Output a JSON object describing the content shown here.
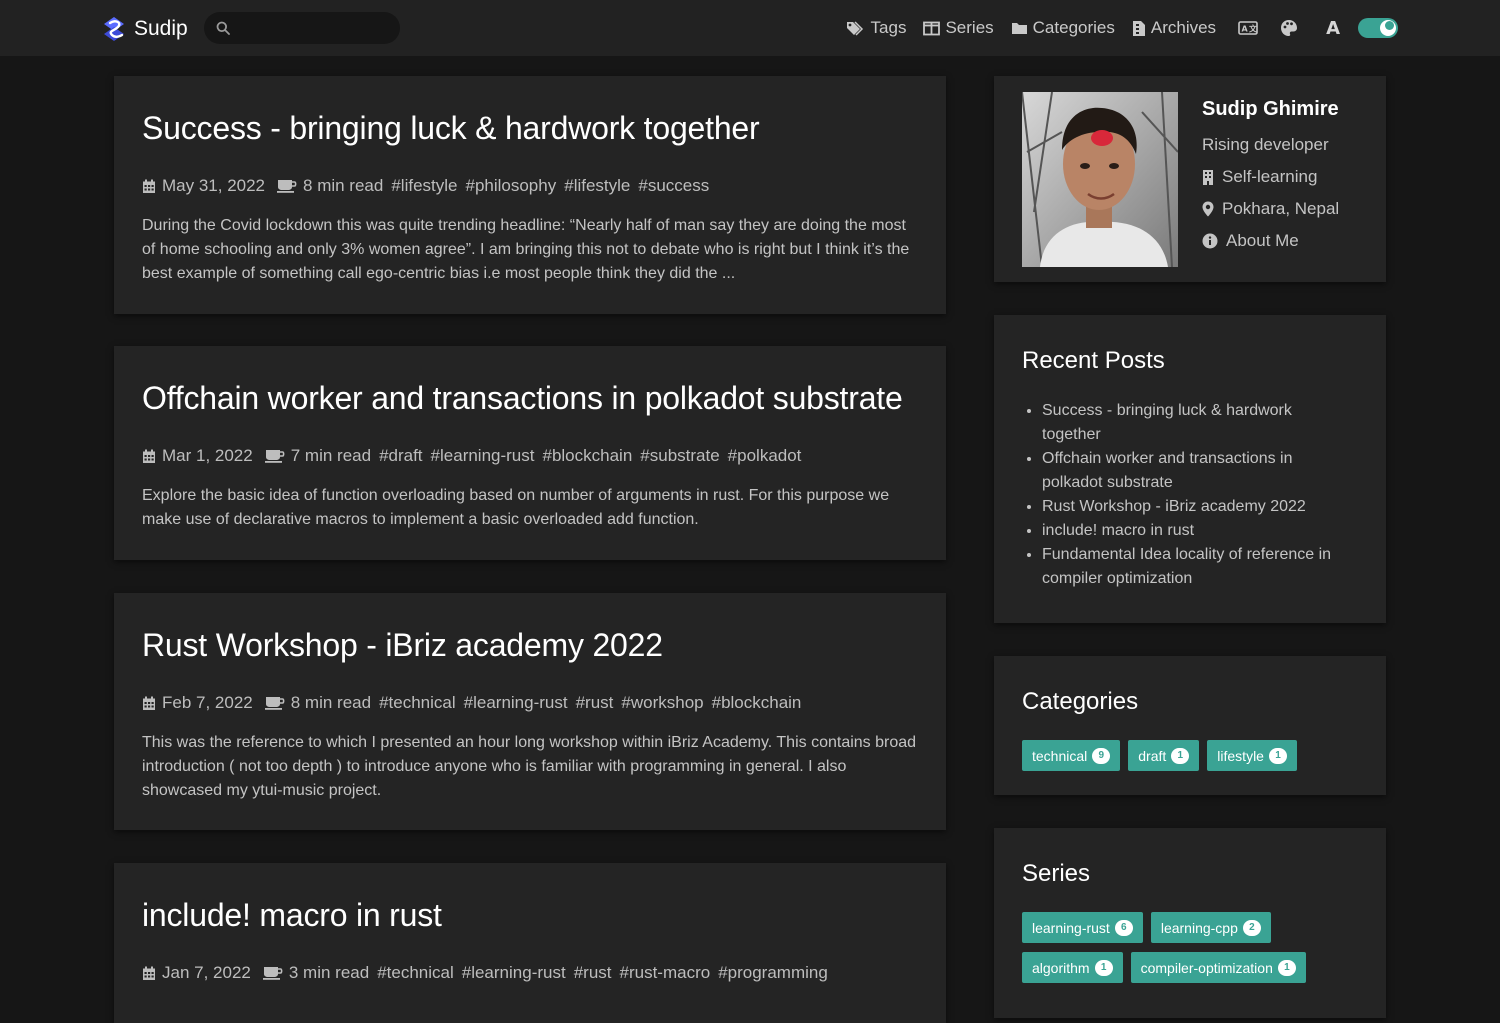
{
  "nav": {
    "brand": "Sudip",
    "search_placeholder": "",
    "links": [
      {
        "label": "Tags",
        "icon": "tags-icon"
      },
      {
        "label": "Series",
        "icon": "series-icon"
      },
      {
        "label": "Categories",
        "icon": "folder-icon"
      },
      {
        "label": "Archives",
        "icon": "archive-icon"
      }
    ],
    "language_icon": "translate-icon",
    "theme_icon": "palette-icon",
    "font_icon": "font-icon",
    "font_glyph": "A",
    "dark_mode": "on"
  },
  "posts": [
    {
      "title": "Success - bringing luck & hardwork together",
      "date": "May 31, 2022",
      "read": "8 min read",
      "tags": [
        "#lifestyle",
        "#philosophy",
        "#lifestyle",
        "#success"
      ],
      "summary": "During the Covid lockdown this was quite trending headline: “Nearly half of man say they are doing the most of home schooling and only 3% women agree”. I am bringing this not to debate who is right but I think it’s the best example of something call ego-centric bias i.e most people think they did the ..."
    },
    {
      "title": "Offchain worker and transactions in polkadot substrate",
      "date": "Mar 1, 2022",
      "read": "7 min read",
      "tags": [
        "#draft",
        "#learning-rust",
        "#blockchain",
        "#substrate",
        "#polkadot"
      ],
      "summary": "Explore the basic idea of function overloading based on number of arguments in rust. For this purpose we make use of declarative macros to implement a basic overloaded add function."
    },
    {
      "title": "Rust Workshop - iBriz academy 2022",
      "date": "Feb 7, 2022",
      "read": "8 min read",
      "tags": [
        "#technical",
        "#learning-rust",
        "#rust",
        "#workshop",
        "#blockchain"
      ],
      "summary": "This was the reference to which I presented an hour long workshop within iBriz Academy. This contains broad introduction ( not too depth ) to introduce anyone who is familiar with programming in general. I also showcased my ytui-music project."
    },
    {
      "title": "include! macro in rust",
      "date": "Jan 7, 2022",
      "read": "3 min read",
      "tags": [
        "#technical",
        "#learning-rust",
        "#rust",
        "#rust-macro",
        "#programming"
      ],
      "summary": ""
    }
  ],
  "profile": {
    "name": "Sudip Ghimire",
    "role": "Rising developer",
    "org": "Self-learning",
    "location": "Pokhara, Nepal",
    "about": "About Me"
  },
  "recent": {
    "title": "Recent Posts",
    "items": [
      "Success - bringing luck & hardwork together",
      "Offchain worker and transactions in polkadot substrate",
      "Rust Workshop - iBriz academy 2022",
      "include! macro in rust",
      "Fundamental Idea locality of reference in compiler optimization"
    ]
  },
  "categories": {
    "title": "Categories",
    "items": [
      {
        "label": "technical",
        "count": "9"
      },
      {
        "label": "draft",
        "count": "1"
      },
      {
        "label": "lifestyle",
        "count": "1"
      }
    ]
  },
  "series": {
    "title": "Series",
    "items": [
      {
        "label": "learning-rust",
        "count": "6"
      },
      {
        "label": "learning-cpp",
        "count": "2"
      },
      {
        "label": "algorithm",
        "count": "1"
      },
      {
        "label": "compiler-optimization",
        "count": "1"
      }
    ]
  },
  "colors": {
    "background": "#161616",
    "navbar": "#222222",
    "card": "#242424",
    "accent": "#3aa394",
    "title": "#ffffff",
    "text": "#c4c4c4"
  }
}
